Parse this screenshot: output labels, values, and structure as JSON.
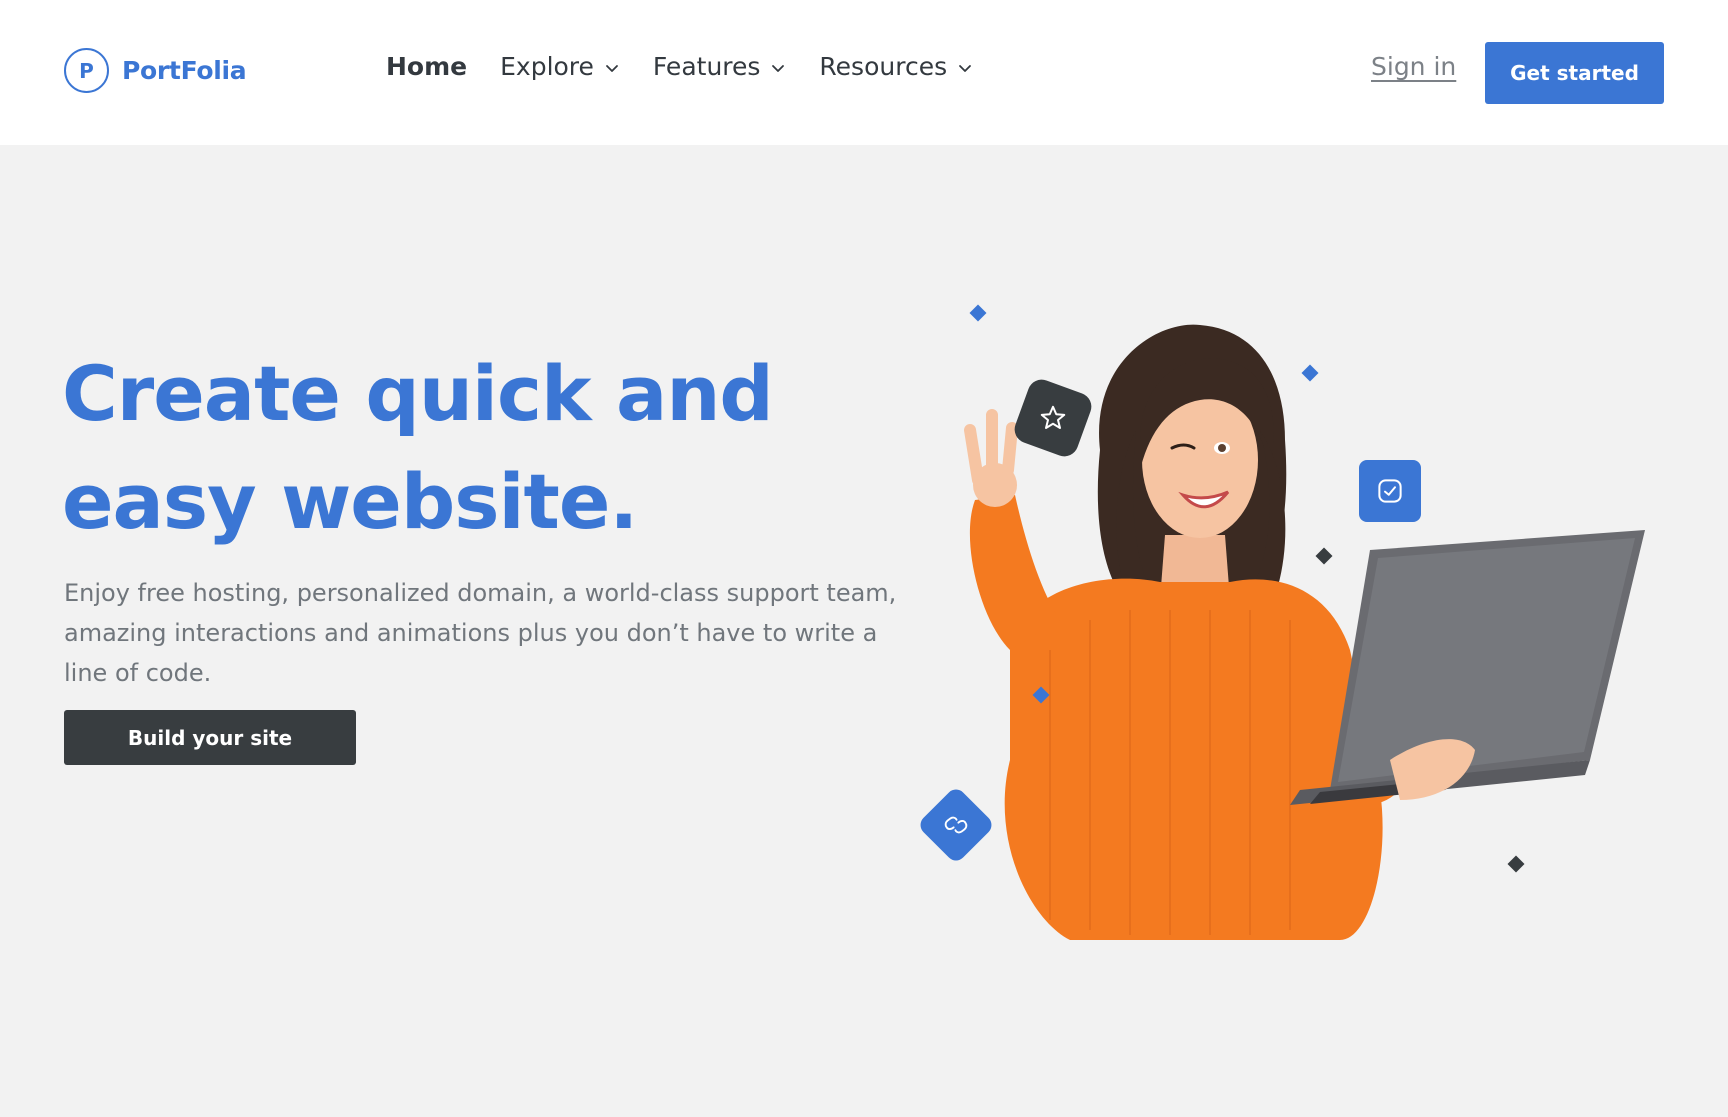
{
  "brand": {
    "logo_letter": "P",
    "name": "PortFolia",
    "color": "#3b76d4"
  },
  "nav": {
    "items": [
      {
        "label": "Home",
        "active": true,
        "has_dropdown": false
      },
      {
        "label": "Explore",
        "active": false,
        "has_dropdown": true
      },
      {
        "label": "Features",
        "active": false,
        "has_dropdown": true
      },
      {
        "label": "Resources",
        "active": false,
        "has_dropdown": true
      }
    ],
    "sign_in": "Sign in",
    "cta": "Get started"
  },
  "hero": {
    "title_line1": "Create quick and",
    "title_line2": "easy website.",
    "subtitle": "Enjoy free hosting, personalized domain, a world-class support team, amazing interactions and animations plus you don’t have to write a line of code.",
    "button": "Build your site"
  },
  "illustration": {
    "icons": [
      "star-icon",
      "check-square-icon",
      "link-icon",
      "laptop-icon"
    ]
  },
  "colors": {
    "accent": "#3b76d4",
    "dark": "#383d40",
    "sweater": "#f47a20",
    "background": "#f2f2f2"
  }
}
